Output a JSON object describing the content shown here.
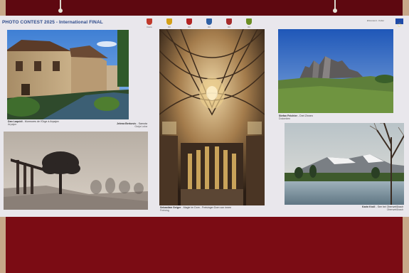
{
  "board": {
    "title": "PHOTO CONTEST 2025 - International FINAL",
    "sponsor_text": "Ehrenwert - Kultur"
  },
  "logos": [
    {
      "name": "crest-1",
      "color": "#c0392b",
      "caption": "Krems"
    },
    {
      "name": "crest-2",
      "color": "#d4a017",
      "caption": "Ort"
    },
    {
      "name": "crest-3",
      "color": "#b22222",
      "caption": "Ort"
    },
    {
      "name": "crest-4",
      "color": "#2e5fa3",
      "caption": "Ort"
    },
    {
      "name": "crest-5",
      "color": "#a52a2a",
      "caption": "Ort"
    },
    {
      "name": "crest-6",
      "color": "#6b8e23",
      "caption": "Ort"
    }
  ],
  "photos": [
    {
      "id": "canal",
      "author": "Dan Laquidi",
      "title": "Murmures de l'Orge à Arpajon",
      "place": "Arpajon"
    },
    {
      "id": "trees",
      "author": "Jelena Berkovic",
      "title": "Samota",
      "place": "Gorja Luka"
    },
    {
      "id": "cathedral",
      "author": "Sebastian Geiger",
      "title": "Magie im Dom - Freisinger Dom von innen",
      "place": "Freising"
    },
    {
      "id": "mountains",
      "author": "Stefan Feichter",
      "title": "Drei Zinnen",
      "place": "Dolomiten"
    },
    {
      "id": "lake",
      "author": "Karin Kroll",
      "title": "See bei Oberweißbach",
      "place": "Oberweißbach"
    }
  ]
}
